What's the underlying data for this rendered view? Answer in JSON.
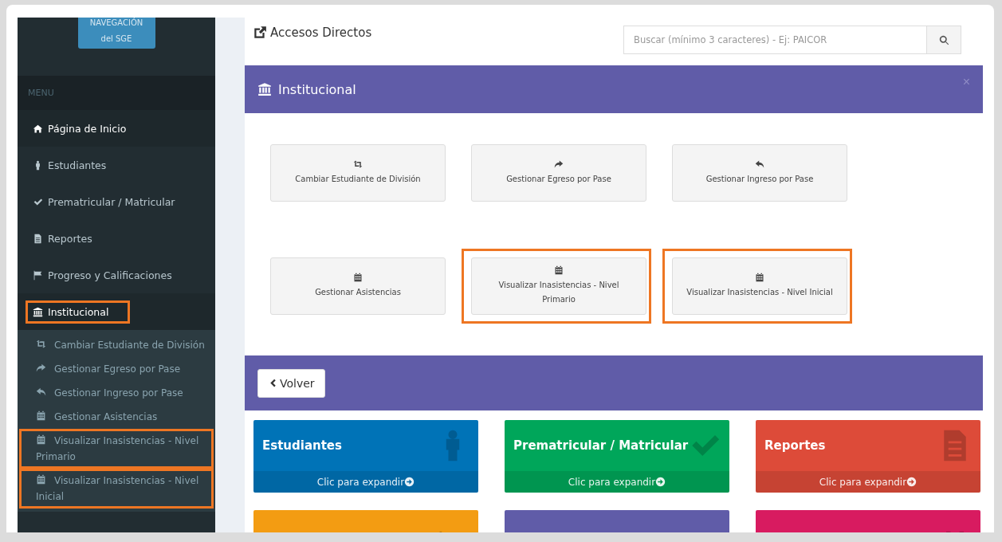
{
  "sidebar": {
    "nav_button": "NAVEGACIÓN del SGE",
    "menu_header": "MENU",
    "items": [
      {
        "label": "Página de Inicio",
        "kind": "home",
        "selected": true,
        "highlighted": false
      },
      {
        "label": "Estudiantes",
        "kind": "person",
        "selected": false,
        "highlighted": false
      },
      {
        "label": "Prematricular / Matricular",
        "kind": "check",
        "selected": false,
        "highlighted": false
      },
      {
        "label": "Reportes",
        "kind": "file",
        "selected": false,
        "highlighted": false
      },
      {
        "label": "Progreso y Calificaciones",
        "kind": "flag",
        "selected": false,
        "highlighted": false
      },
      {
        "label": "Institucional",
        "kind": "bank",
        "selected": true,
        "highlighted": true,
        "expanded": true,
        "children": [
          {
            "label": "Cambiar Estudiante de División",
            "kind": "retweet",
            "highlighted": false
          },
          {
            "label": "Gestionar Egreso por Pase",
            "kind": "share",
            "highlighted": false
          },
          {
            "label": "Gestionar Ingreso por Pase",
            "kind": "reply",
            "highlighted": false
          },
          {
            "label": "Gestionar Asistencias",
            "kind": "calendar",
            "highlighted": false
          },
          {
            "label": "Visualizar Inasistencias - Nivel Primario",
            "kind": "calendar",
            "highlighted": true
          },
          {
            "label": "Visualizar Inasistencias - Nivel Inicial",
            "kind": "calendar",
            "highlighted": true
          }
        ]
      }
    ]
  },
  "header": {
    "title": "Accesos Directos",
    "search": {
      "placeholder": "Buscar (mínimo 3 caracteres) - Ej: PAICOR"
    }
  },
  "panel": {
    "title": "Institucional",
    "close": "×",
    "shortcuts": [
      {
        "label": "Cambiar Estudiante de División",
        "kind": "retweet",
        "highlighted": false
      },
      {
        "label": "Gestionar Egreso por Pase",
        "kind": "share",
        "highlighted": false
      },
      {
        "label": "Gestionar Ingreso por Pase",
        "kind": "reply",
        "highlighted": false
      },
      {
        "label": "Gestionar Asistencias",
        "kind": "calendar",
        "highlighted": false
      },
      {
        "label": "Visualizar Inasistencias - Nivel Primario",
        "kind": "calendar",
        "highlighted": true
      },
      {
        "label": "Visualizar Inasistencias - Nivel Inicial",
        "kind": "calendar",
        "highlighted": true
      }
    ],
    "back_button": "Volver"
  },
  "tiles": [
    {
      "title": "Estudiantes",
      "footer": "Clic para expandir",
      "color": "#0073b7",
      "kind": "person"
    },
    {
      "title": "Prematricular / Matricular",
      "footer": "Clic para expandir",
      "color": "#00a65a",
      "kind": "check"
    },
    {
      "title": "Reportes",
      "footer": "Clic para expandir",
      "color": "#dd4b39",
      "kind": "file"
    },
    {
      "color": "#f39c12",
      "kind": "flag"
    },
    {
      "color": "#605ca8",
      "kind": "cap"
    },
    {
      "color": "#d81b60",
      "kind": "calendar"
    }
  ]
}
